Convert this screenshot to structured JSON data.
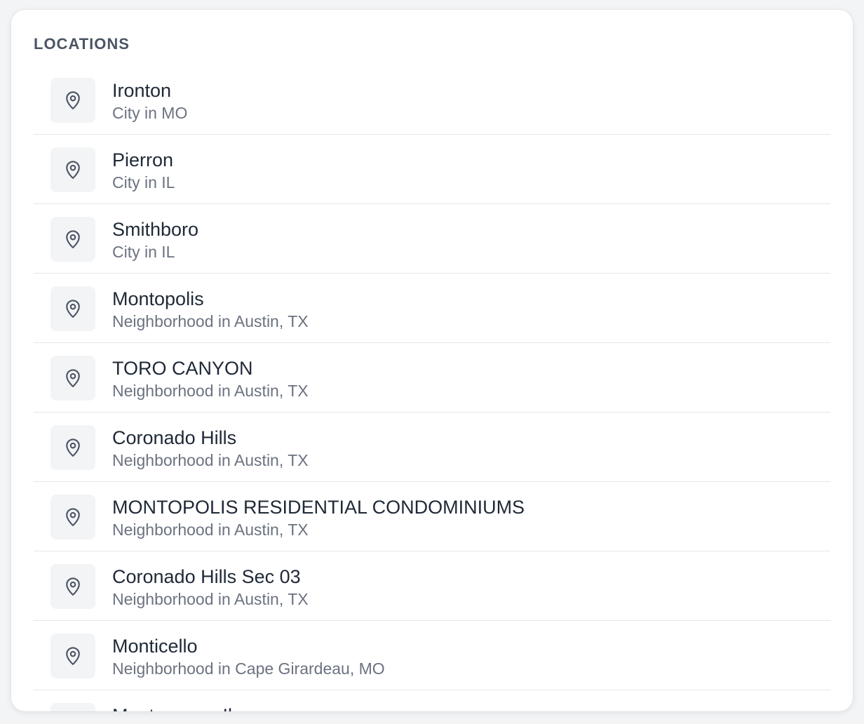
{
  "section": {
    "title": "LOCATIONS"
  },
  "icons": {
    "location": "map-pin-icon"
  },
  "locations": [
    {
      "name": "Ironton",
      "subtitle": "City in MO"
    },
    {
      "name": "Pierron",
      "subtitle": "City in IL"
    },
    {
      "name": "Smithboro",
      "subtitle": "City in IL"
    },
    {
      "name": "Montopolis",
      "subtitle": "Neighborhood in Austin, TX"
    },
    {
      "name": "TORO CANYON",
      "subtitle": "Neighborhood in Austin, TX"
    },
    {
      "name": "Coronado Hills",
      "subtitle": "Neighborhood in Austin, TX"
    },
    {
      "name": "MONTOPOLIS RESIDENTIAL CONDOMINIUMS",
      "subtitle": "Neighborhood in Austin, TX"
    },
    {
      "name": "Coronado Hills Sec 03",
      "subtitle": "Neighborhood in Austin, TX"
    },
    {
      "name": "Monticello",
      "subtitle": "Neighborhood in Cape Girardeau, MO"
    },
    {
      "name": "Montgomery Il",
      "subtitle": ""
    }
  ]
}
